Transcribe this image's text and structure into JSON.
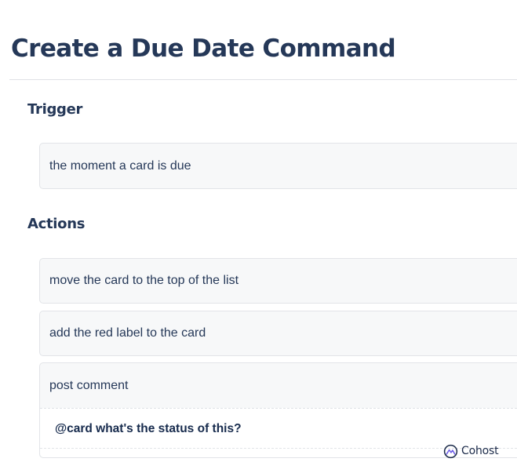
{
  "page": {
    "title": "Create a Due Date Command"
  },
  "trigger": {
    "heading": "Trigger",
    "value": "the moment a card is due"
  },
  "actions": {
    "heading": "Actions",
    "items": [
      {
        "label": "move the card to the top of the list"
      },
      {
        "label": "add the red label to the card"
      },
      {
        "label": "post comment",
        "comment": "@card what's the status of this?"
      }
    ]
  },
  "watermark": {
    "brand": "Cohost",
    "icon": "cohost-logo-icon",
    "color": "#1c2b4a"
  },
  "colors": {
    "heading": "#253858",
    "card_background": "#f7f8f9",
    "card_border": "#e2e4e8"
  }
}
